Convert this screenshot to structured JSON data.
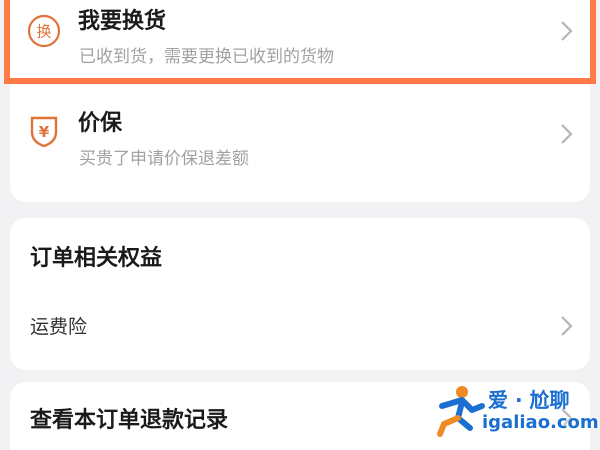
{
  "options": [
    {
      "title": "我要换货",
      "description": "已收到货，需要更换已收到的货物",
      "icon": "exchange-icon",
      "icon_glyph": "换",
      "highlighted": true
    },
    {
      "title": "价保",
      "description": "买贵了申请价保退差额",
      "icon": "price-protection-icon",
      "icon_glyph": "¥",
      "highlighted": false
    }
  ],
  "benefits": {
    "title": "订单相关权益",
    "items": [
      {
        "label": "运费险"
      }
    ]
  },
  "refund": {
    "title": "查看本订单退款记录"
  },
  "watermark": {
    "line1": "爱 · 尬聊",
    "line2": "igaliao.com"
  },
  "colors": {
    "accent": "#ff7a45",
    "icon_orange": "#e0733a",
    "watermark_blue": "#1b6fd1",
    "watermark_orange": "#f08a24"
  }
}
